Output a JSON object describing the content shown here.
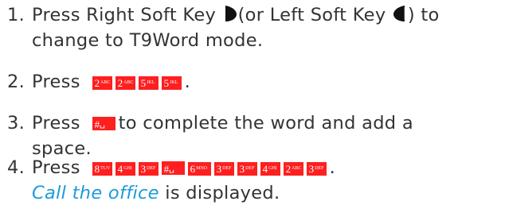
{
  "steps": [
    {
      "number": "1.",
      "line1_before": "Press Right Soft Key ",
      "line1_mid": "(or Left Soft Key ",
      "line1_after": ") to",
      "line2": "change to T9Word mode.",
      "icons": [
        "right-soft-key-icon",
        "left-soft-key-icon"
      ]
    },
    {
      "number": "2.",
      "text": "Press",
      "keys": [
        {
          "main": "2",
          "sub": "ABC"
        },
        {
          "main": "2",
          "sub": "ABC"
        },
        {
          "main": "5",
          "sub": "JKL"
        },
        {
          "main": "5",
          "sub": "JKL"
        }
      ],
      "end": "."
    },
    {
      "number": "3.",
      "before": "Press",
      "key": {
        "main": "#",
        "sub": "␣"
      },
      "after": "to complete the word and add a",
      "line2": "space."
    },
    {
      "number": "4.",
      "text": "Press",
      "keys": [
        {
          "main": "8",
          "sub": "TUV"
        },
        {
          "main": "4",
          "sub": "GHI"
        },
        {
          "main": "3",
          "sub": "DEF"
        },
        {
          "main": "#",
          "sub": "␣"
        },
        {
          "main": "6",
          "sub": "MNO"
        },
        {
          "main": "3",
          "sub": "DEF"
        },
        {
          "main": "3",
          "sub": "DEF"
        },
        {
          "main": "4",
          "sub": "GHI"
        },
        {
          "main": "2",
          "sub": "ABC"
        },
        {
          "main": "3",
          "sub": "DEF"
        }
      ],
      "end": ".",
      "result_italic": "Call the office",
      "result_rest": " is displayed."
    }
  ],
  "colors": {
    "text": "#333333",
    "key_background": "#ff1f1f",
    "key_text": "#ffffff",
    "highlight": "#1e9bd7"
  }
}
